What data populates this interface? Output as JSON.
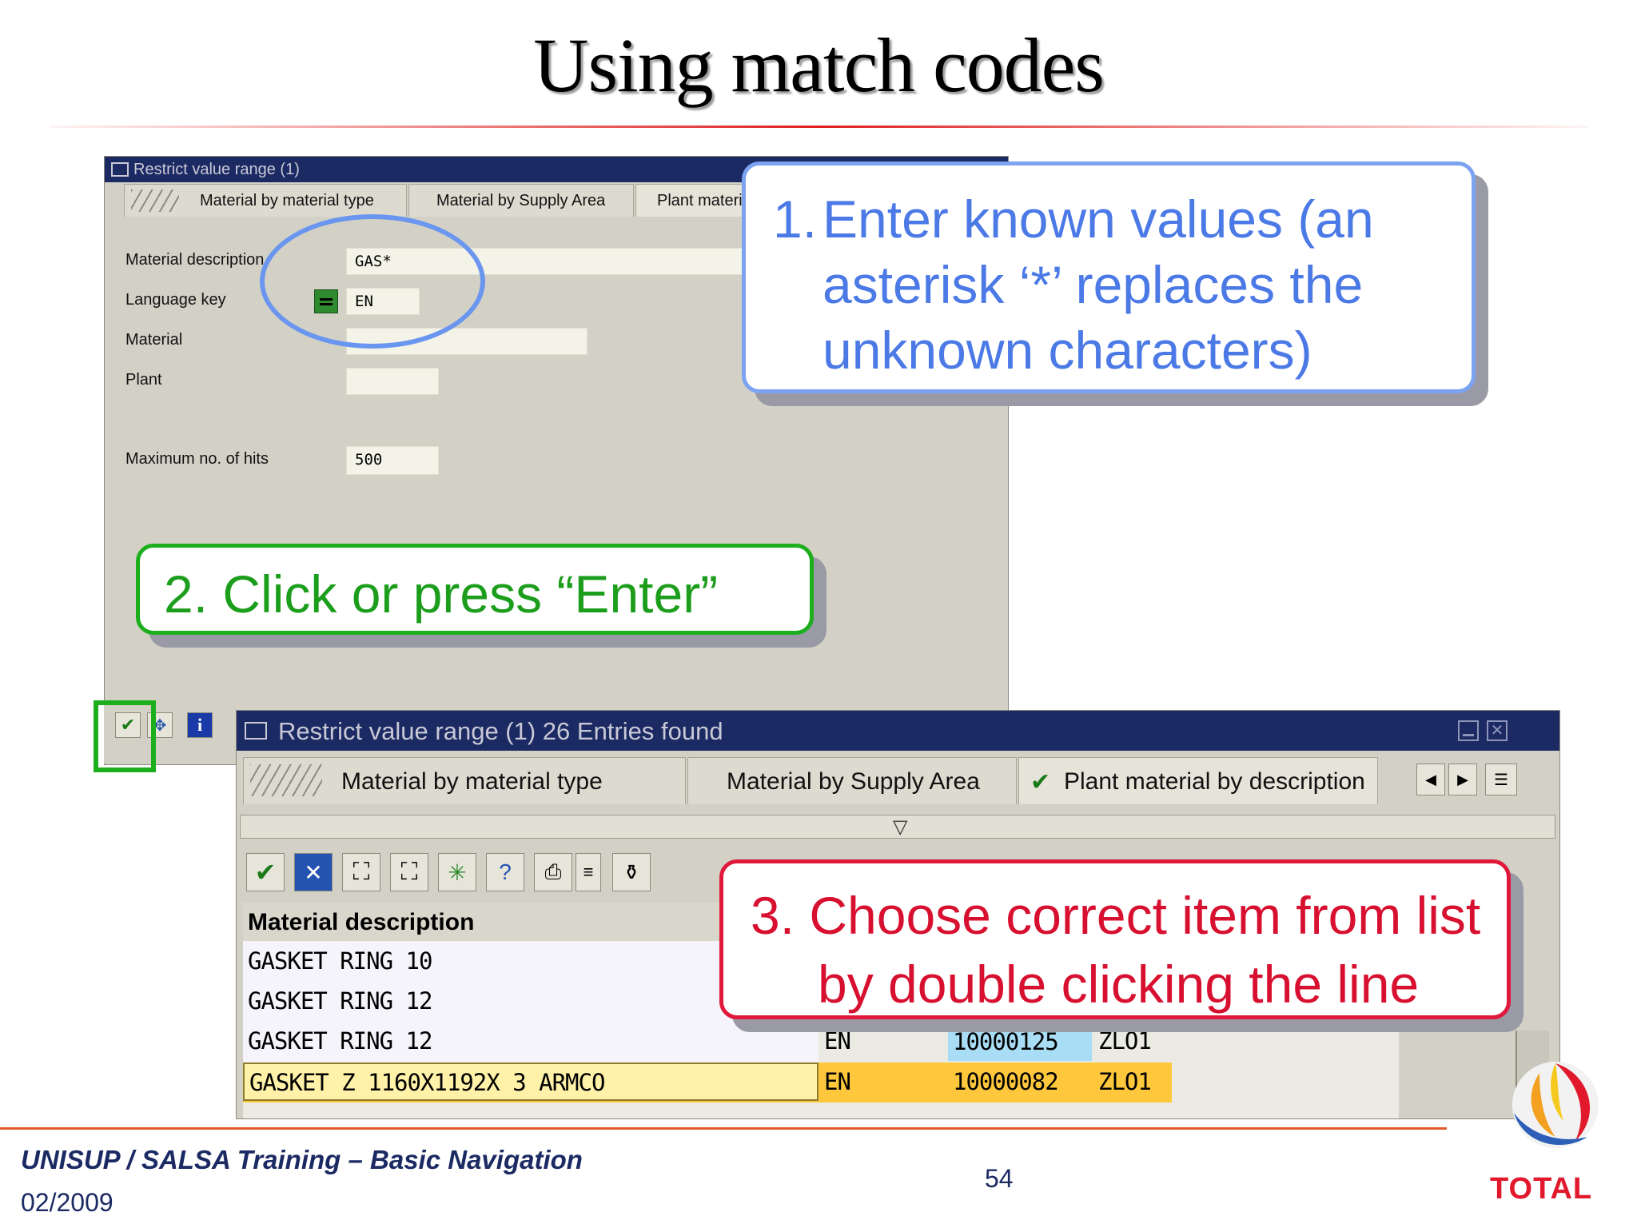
{
  "slide": {
    "title": "Using match codes",
    "footer_title": "UNISUP / SALSA Training – Basic Navigation",
    "footer_date": "02/2009",
    "page_number": "54",
    "logo_text": "TOTAL"
  },
  "dialog1": {
    "title": "Restrict value range (1)",
    "tabs": [
      "Material by material type",
      "Material by Supply Area",
      "Plant materi"
    ],
    "fields": [
      {
        "label": "Material description",
        "value": "GAS*"
      },
      {
        "label": "Language key",
        "value": "EN"
      },
      {
        "label": "Material",
        "value": ""
      },
      {
        "label": "Plant",
        "value": ""
      },
      {
        "label": "Maximum no. of hits",
        "value": "500"
      }
    ]
  },
  "dialog2": {
    "title": "Restrict value range (1)   26 Entries found",
    "tabs": [
      "Material by material type",
      "Material by Supply Area",
      "Plant material by description"
    ],
    "filter_marker": "▽",
    "column_header": "Material description",
    "rows": [
      {
        "description": "GASKET RING 10",
        "lang": "",
        "material": "",
        "plant": "",
        "selected": false
      },
      {
        "description": "GASKET RING 12",
        "lang": "",
        "material": "",
        "plant": "",
        "selected": false
      },
      {
        "description": "GASKET RING 12",
        "lang": "EN",
        "material": "10000125",
        "plant": "ZLO1",
        "selected": false
      },
      {
        "description": "GASKET Z 1160X1192X 3 ARMCO",
        "lang": "EN",
        "material": "10000082",
        "plant": "ZLO1",
        "selected": true
      }
    ]
  },
  "callouts": {
    "step1": [
      "1.",
      "Enter known values (an",
      "asterisk ‘*’ replaces the",
      "unknown characters)"
    ],
    "step2": "2. Click or press “Enter”",
    "step3": [
      "3. Choose correct item from list",
      "by double clicking the line"
    ]
  },
  "colors": {
    "sap_title_bar": "#1c2a64",
    "callout1": "#4b79e6",
    "callout2": "#1c9e1c",
    "callout3": "#d81030",
    "selected_row": "#ffc83c"
  }
}
